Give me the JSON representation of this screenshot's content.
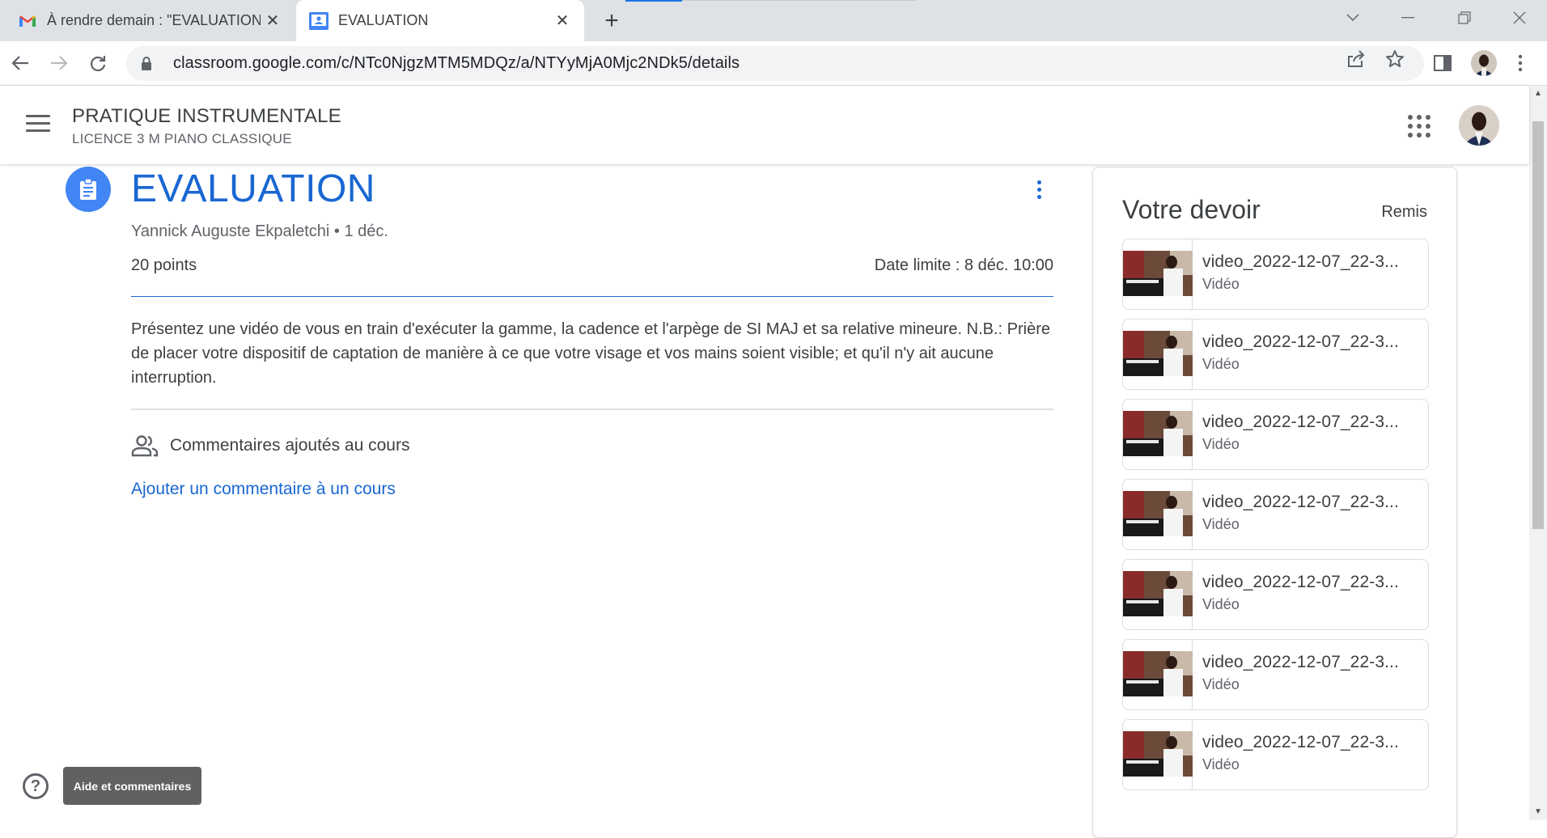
{
  "browser": {
    "tabs": [
      {
        "title": "À rendre demain : \"EVALUATION\"",
        "favicon": "gmail-icon",
        "active": false
      },
      {
        "title": "EVALUATION",
        "favicon": "classroom-icon",
        "active": true
      }
    ],
    "url": "classroom.google.com/c/NTc0NjgzMTM5MDQz/a/NTYyMjA0Mjc2NDk5/details"
  },
  "classroom": {
    "class_name": "PRATIQUE INSTRUMENTALE",
    "class_section": "LICENCE 3 M PIANO CLASSIQUE"
  },
  "assignment": {
    "title": "EVALUATION",
    "author_date": "Yannick Auguste Ekpaletchi • 1 déc.",
    "points": "20 points",
    "deadline": "Date limite : 8 déc. 10:00",
    "description": "Présentez une vidéo de vous en train d'exécuter la gamme, la cadence et l'arpège de SI MAJ et sa relative mineure. N.B.: Prière de placer votre dispositif de captation de manière à ce que votre visage et vos mains soient visible; et qu'il n'y ait aucune interruption.",
    "comments_heading": "Commentaires ajoutés au cours",
    "add_comment_link": "Ajouter un commentaire à un cours"
  },
  "panel": {
    "title": "Votre devoir",
    "status": "Remis",
    "attachments": [
      {
        "name": "video_2022-12-07_22-3...",
        "kind": "Vidéo"
      },
      {
        "name": "video_2022-12-07_22-3...",
        "kind": "Vidéo"
      },
      {
        "name": "video_2022-12-07_22-3...",
        "kind": "Vidéo"
      },
      {
        "name": "video_2022-12-07_22-3...",
        "kind": "Vidéo"
      },
      {
        "name": "video_2022-12-07_22-3...",
        "kind": "Vidéo"
      },
      {
        "name": "video_2022-12-07_22-3...",
        "kind": "Vidéo"
      },
      {
        "name": "video_2022-12-07_22-3...",
        "kind": "Vidéo"
      }
    ]
  },
  "help": {
    "tooltip": "Aide et commentaires"
  },
  "colors": {
    "accent": "#1967d2",
    "icon_bg": "#4285f4",
    "tooltip_bg": "#616161"
  }
}
